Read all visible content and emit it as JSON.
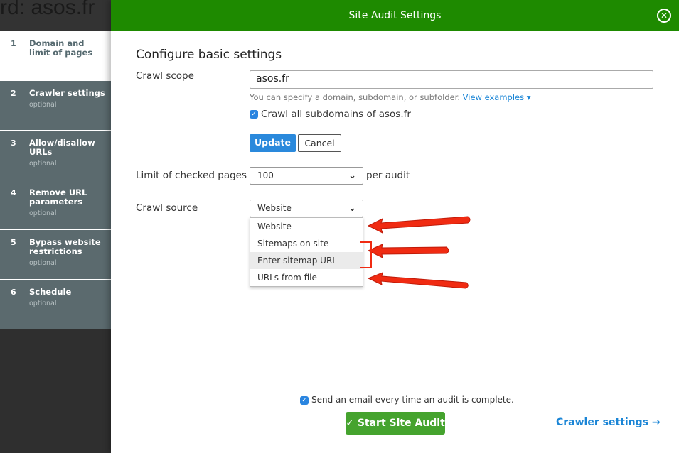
{
  "background": {
    "title": "rd: asos.fr"
  },
  "steps": [
    {
      "num": "1",
      "title": "Domain and limit of pages",
      "sub": ""
    },
    {
      "num": "2",
      "title": "Crawler settings",
      "sub": "optional"
    },
    {
      "num": "3",
      "title": "Allow/disallow URLs",
      "sub": "optional"
    },
    {
      "num": "4",
      "title": "Remove URL parameters",
      "sub": "optional"
    },
    {
      "num": "5",
      "title": "Bypass website restrictions",
      "sub": "optional"
    },
    {
      "num": "6",
      "title": "Schedule",
      "sub": "optional"
    }
  ],
  "modal": {
    "title": "Site Audit Settings",
    "heading": "Configure basic settings",
    "crawl_scope_label": "Crawl scope",
    "crawl_scope_value": "asos.fr",
    "hint": "You can specify a domain, subdomain, or subfolder.",
    "view_examples": "View examples",
    "subdomains_label": "Crawl all subdomains of asos.fr",
    "update": "Update",
    "cancel": "Cancel",
    "limit_label": "Limit of checked pages",
    "limit_value": "100",
    "per_audit": "per audit",
    "source_label": "Crawl source",
    "source_value": "Website",
    "source_options": [
      "Website",
      "Sitemaps on site",
      "Enter sitemap URL",
      "URLs from file"
    ],
    "email_label": "Send an email every time an audit is complete.",
    "start": "Start Site Audit",
    "next": "Crawler settings"
  },
  "colors": {
    "header": "#1e8a00",
    "accent": "#1a85d6",
    "start": "#45a32e",
    "annotation": "#f02b12"
  }
}
